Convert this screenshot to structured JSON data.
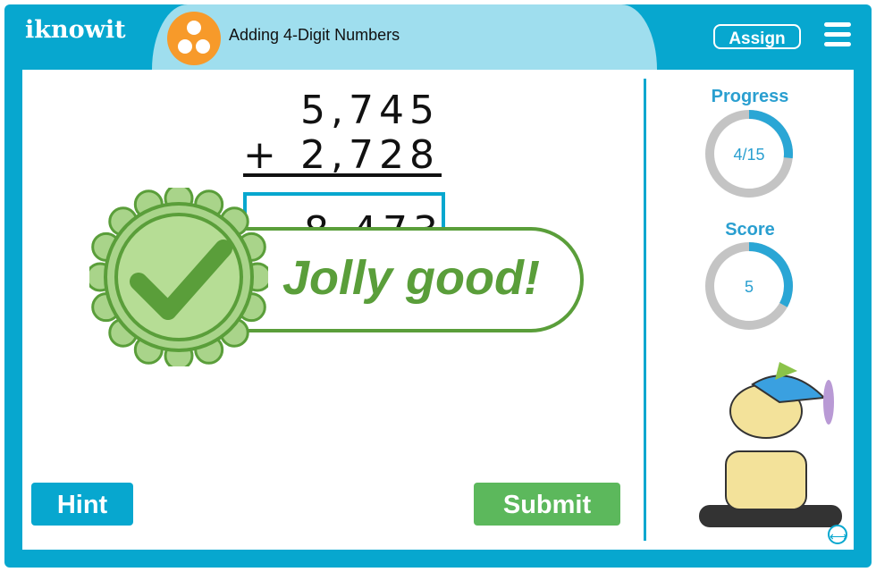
{
  "header": {
    "logo": "iknowit",
    "title": "Adding 4-Digit Numbers",
    "assign_label": "Assign",
    "topic_icon": "three-circles-icon",
    "menu_icon": "hamburger-icon"
  },
  "problem": {
    "addend1": "5,745",
    "operator": "+",
    "addend2": "2,728",
    "answer": "8,473"
  },
  "feedback": {
    "message": "Jolly good!",
    "icon": "checkmark-badge-icon"
  },
  "progress": {
    "label": "Progress",
    "text": "4/15",
    "current": 4,
    "total": 15
  },
  "score": {
    "label": "Score",
    "value": "5",
    "fraction": 0.33
  },
  "buttons": {
    "hint": "Hint",
    "submit": "Submit"
  },
  "colors": {
    "frame": "#07a7cf",
    "title_bar": "#9fdeee",
    "topic": "#f79a2a",
    "success": "#5a9e3a",
    "submit": "#5cb85c"
  }
}
